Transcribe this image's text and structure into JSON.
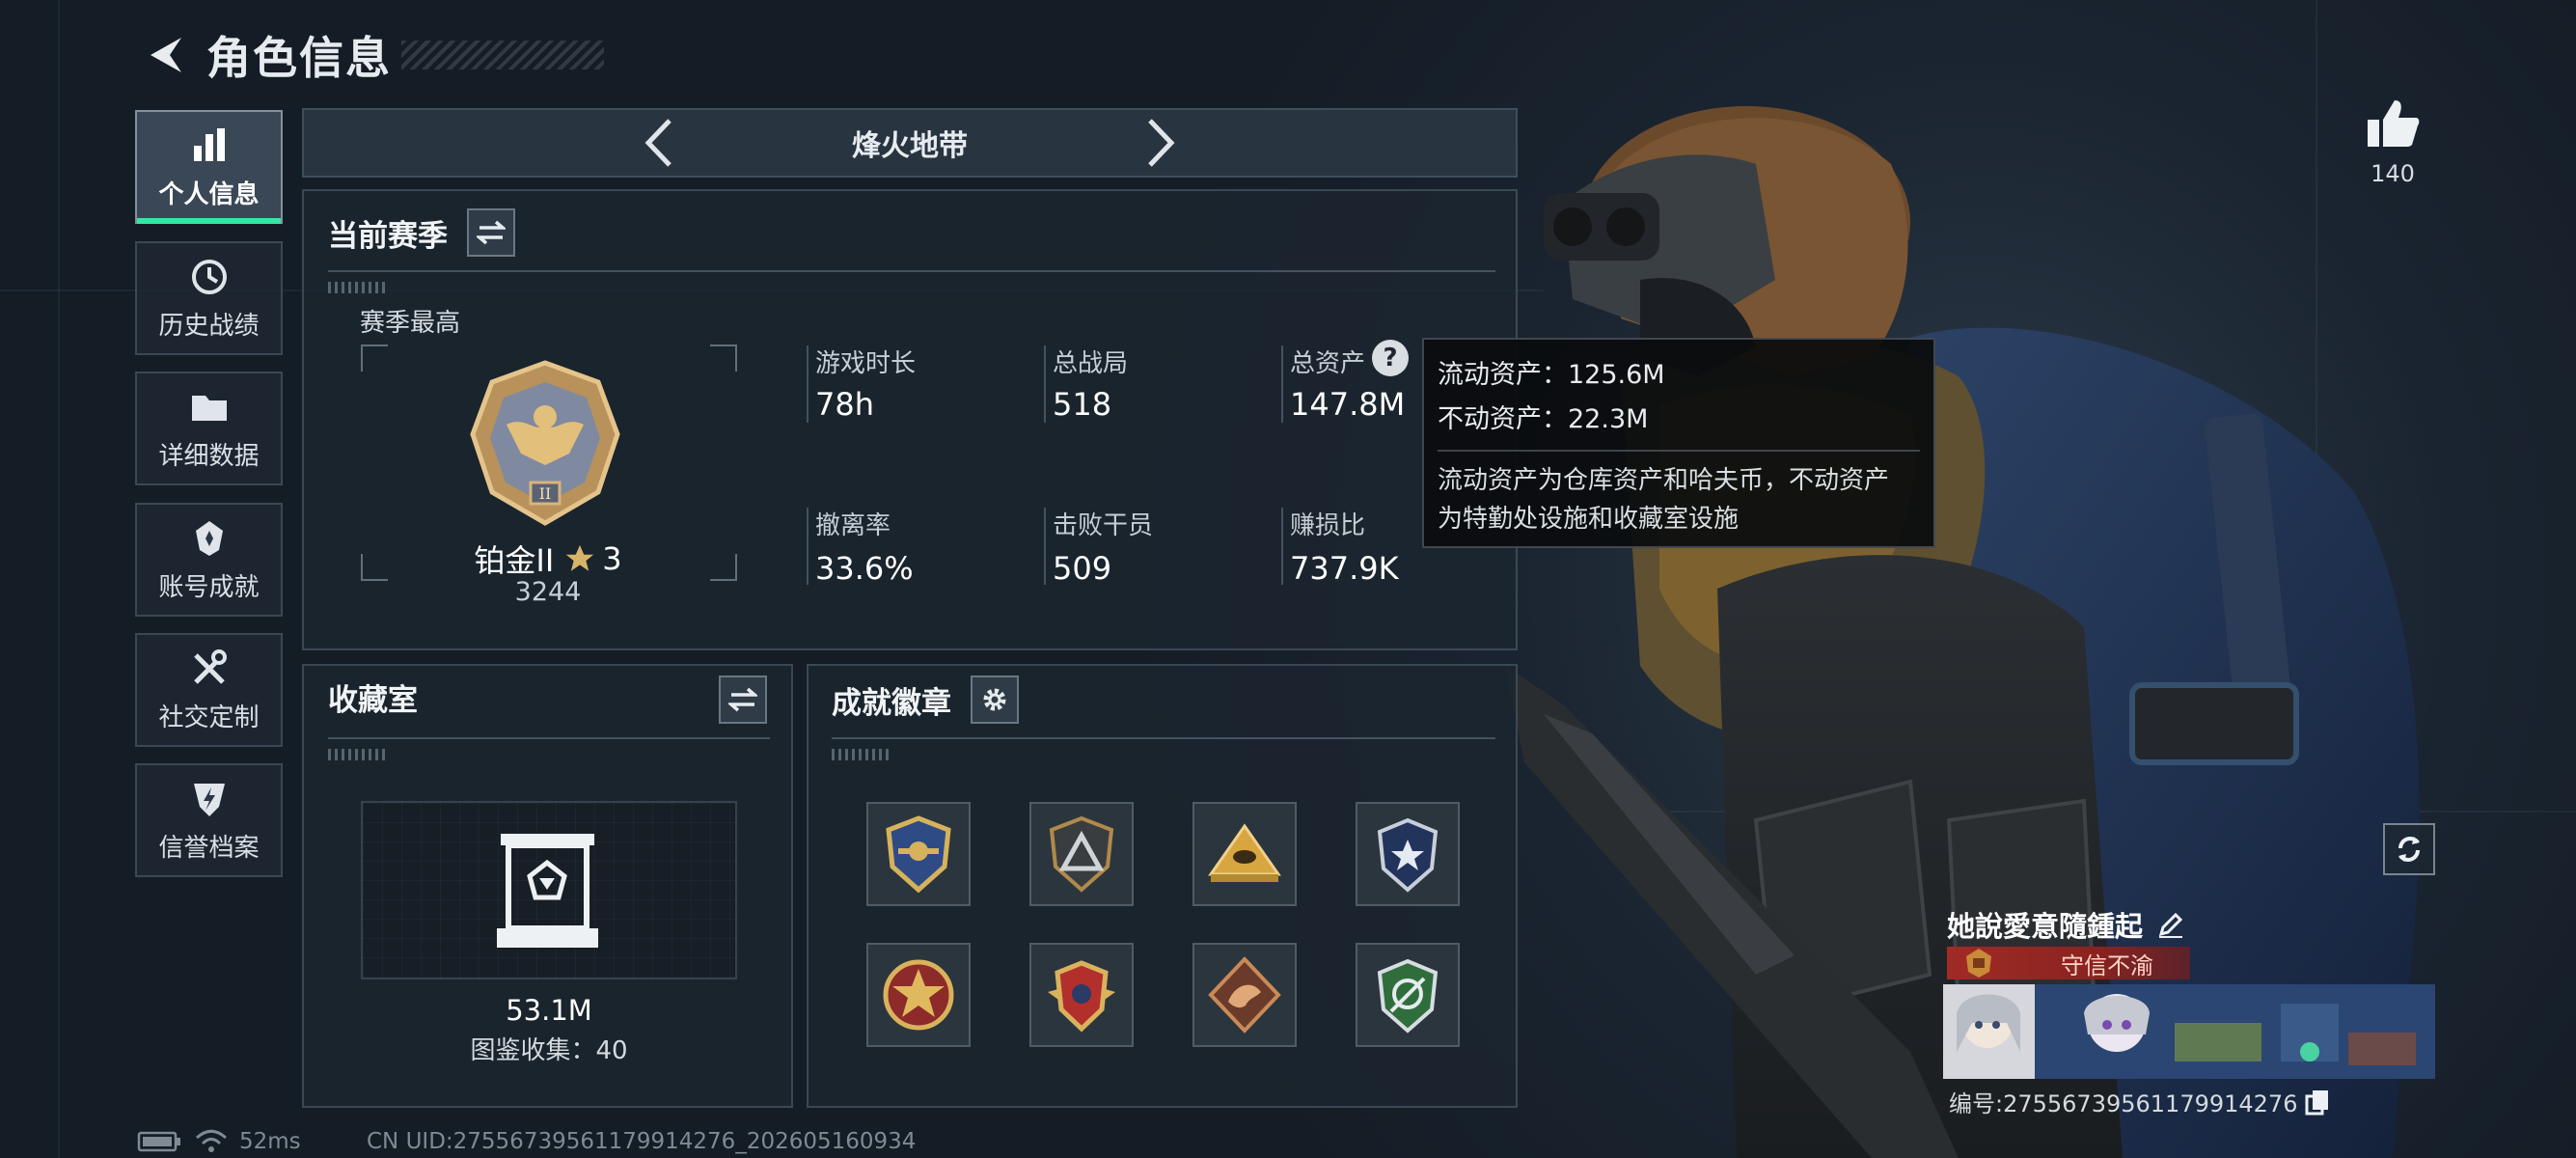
{
  "header": {
    "title": "角色信息"
  },
  "nav": {
    "tabs": [
      {
        "label": "个人信息",
        "icon": "bar-chart-icon",
        "active": true
      },
      {
        "label": "历史战绩",
        "icon": "history-icon",
        "active": false
      },
      {
        "label": "详细数据",
        "icon": "folder-icon",
        "active": false
      },
      {
        "label": "账号成就",
        "icon": "achievement-icon",
        "active": false
      },
      {
        "label": "社交定制",
        "icon": "tools-icon",
        "active": false
      },
      {
        "label": "信誉档案",
        "icon": "credit-icon",
        "active": false
      }
    ]
  },
  "mode": {
    "title": "烽火地带"
  },
  "season": {
    "title": "当前赛季",
    "best_label": "赛季最高",
    "rank_name": "铂金II",
    "rank_stars": "3",
    "rank_points": "3244",
    "stats": [
      {
        "label": "游戏时长",
        "value": "78h"
      },
      {
        "label": "总战局",
        "value": "518"
      },
      {
        "label": "总资产",
        "value": "147.8M"
      },
      {
        "label": "撤离率",
        "value": "33.6%"
      },
      {
        "label": "击败干员",
        "value": "509"
      },
      {
        "label": "赚损比",
        "value": "737.9K"
      }
    ]
  },
  "tooltip": {
    "liquid": "流动资产：125.6M",
    "fixed": "不动资产：22.3M",
    "desc_line1": "流动资产为仓库资产和哈夫币，不动资产",
    "desc_line2": "为特勤处设施和收藏室设施"
  },
  "collection": {
    "title": "收藏室",
    "value": "53.1M",
    "count_text": "图鉴收集：40"
  },
  "badges": {
    "title": "成就徽章",
    "items": [
      "shield-crest-icon",
      "triangle-shield-icon",
      "pyramid-eye-icon",
      "star-wreath-icon",
      "star-medal-icon",
      "winged-crest-icon",
      "dragon-icon",
      "green-shield-icon"
    ]
  },
  "profile": {
    "like_count": "140",
    "name": "她說愛意隨鍾起",
    "title_badge": "守信不渝",
    "id_text": "编号:2755673956117991427​6"
  },
  "status": {
    "ping": "52ms",
    "uid": "CN UID:27556739561179914276_202605160934"
  },
  "colors": {
    "accent": "#34e6a4",
    "title_badge": "#a02b25",
    "background": "#17202a"
  }
}
